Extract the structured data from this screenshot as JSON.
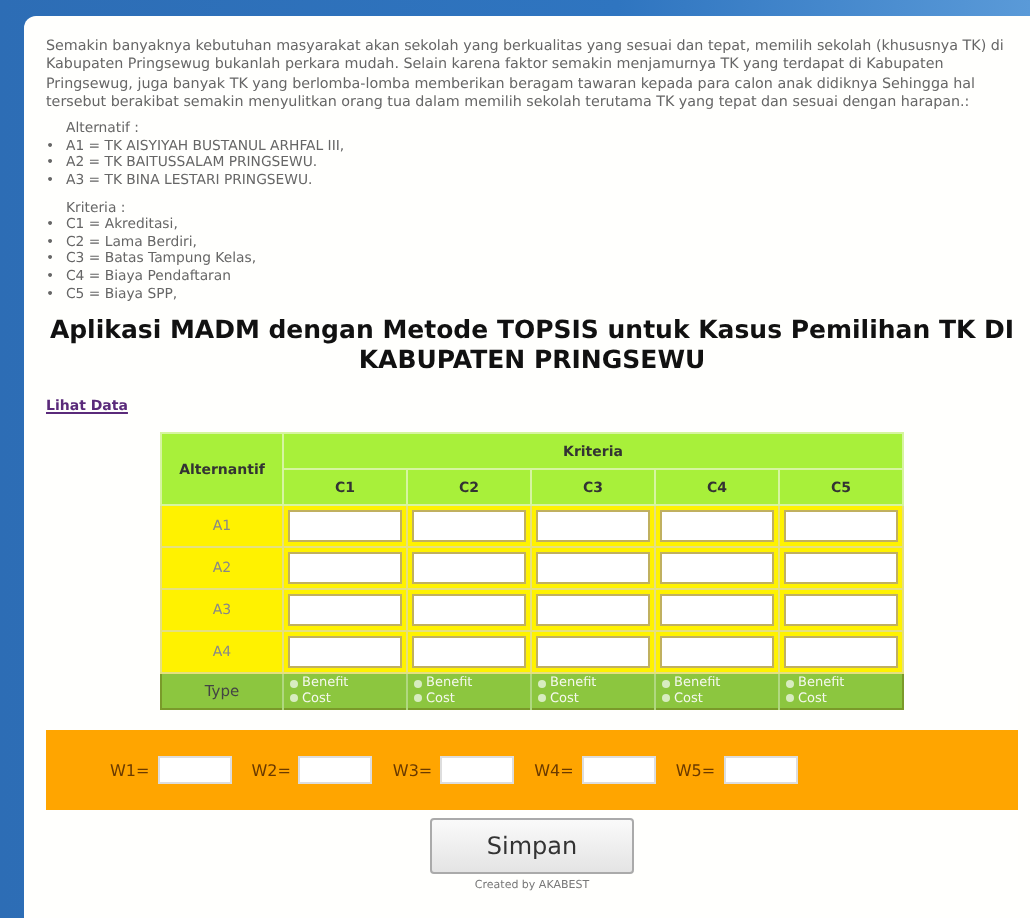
{
  "intro": "Semakin banyaknya kebutuhan masyarakat akan sekolah yang berkualitas yang sesuai dan tepat, memilih sekolah (khususnya TK) di Kabupaten Pringsewug bukanlah perkara mudah. Selain karena faktor semakin menjamurnya TK yang terdapat di Kabupaten Pringsewug, juga banyak TK yang berlomba-lomba memberikan beragam tawaran kepada para calon anak didiknya Sehingga hal tersebut berakibat semakin menyulitkan orang tua dalam memilih sekolah terutama TK yang tepat dan sesuai dengan harapan.:",
  "lists": [
    {
      "heading": "Alternatif :",
      "items": [
        {
          "bullet": "•",
          "text": "A1 = TK AISYIYAH BUSTANUL ARHFAL III,"
        },
        {
          "bullet": "•",
          "text": "A2 = TK BAITUSSALAM PRINGSEWU."
        },
        {
          "bullet": "•",
          "text": "A3 = TK BINA LESTARI PRINGSEWU."
        }
      ]
    },
    {
      "heading": "Kriteria :",
      "items": [
        {
          "bullet": "•",
          "text": "C1 = Akreditasi,"
        },
        {
          "bullet": "•",
          "text": "C2 = Lama Berdiri,"
        },
        {
          "bullet": "•",
          "text": "C3 = Batas Tampung Kelas,"
        },
        {
          "bullet": "•",
          "text": "C4 = Biaya Pendaftaran"
        },
        {
          "bullet": "•",
          "text": "C5 = Biaya SPP,"
        }
      ]
    }
  ],
  "title": "Aplikasi MADM dengan Metode TOPSIS untuk Kasus Pemilihan TK DI KABUPATEN PRINGSEWU",
  "link": "Lihat Data",
  "table": {
    "corner": "Alternantif",
    "group": "Kriteria",
    "columns": [
      "C1",
      "C2",
      "C3",
      "C4",
      "C5"
    ],
    "rows": [
      "A1",
      "A2",
      "A3",
      "A4"
    ],
    "type_label": "Type",
    "types": [
      [
        {
          "label": "Benefit",
          "selected": false
        },
        {
          "label": "Cost",
          "selected": false
        }
      ],
      [
        {
          "label": "Benefit",
          "selected": false
        },
        {
          "label": "Cost",
          "selected": false
        }
      ],
      [
        {
          "label": "Benefit",
          "selected": false
        },
        {
          "label": "Cost",
          "selected": false
        }
      ],
      [
        {
          "label": "Benefit",
          "selected": false
        },
        {
          "label": "Cost",
          "selected": false
        }
      ],
      [
        {
          "label": "Benefit",
          "selected": false
        },
        {
          "label": "Cost",
          "selected": false
        }
      ]
    ]
  },
  "weights": [
    "W1=",
    "W2=",
    "W3=",
    "W4=",
    "W5="
  ],
  "button": "Simpan",
  "footer": "Created by AKABEST"
}
